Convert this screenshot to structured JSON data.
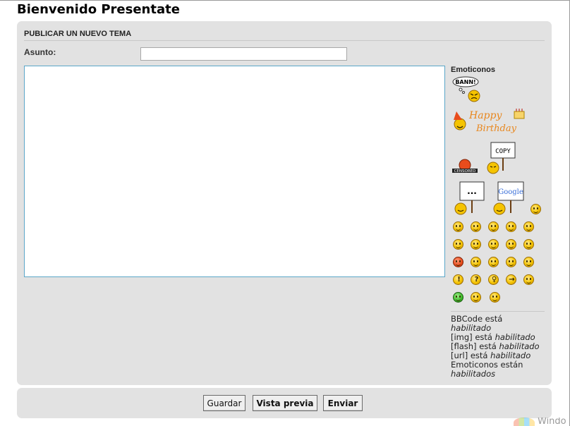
{
  "page": {
    "title": "Bienvenido Presentate"
  },
  "form": {
    "section_title": "PUBLICAR UN NUEVO TEMA",
    "subject_label": "Asunto:",
    "subject_value": "",
    "message_value": ""
  },
  "emoticons": {
    "title": "Emoticonos",
    "large": [
      {
        "name": "bann-smiley-icon",
        "text": "BANN!"
      },
      {
        "name": "happy-birthday-smiley-icon",
        "text": "Happy Birthday"
      },
      {
        "name": "censored-smiley-icon",
        "text": "CENSORED"
      },
      {
        "name": "copy-sign-smiley-icon",
        "text": "COPY"
      },
      {
        "name": "speechless-sign-smiley-icon",
        "text": "..."
      },
      {
        "name": "google-sign-smiley-icon",
        "text": "Google"
      }
    ],
    "small": [
      "big-grin-icon",
      "smile-icon",
      "wink-icon",
      "shy-icon",
      "surprised-icon",
      "rolling-eyes-icon",
      "confused-icon",
      "cool-icon",
      "laugh-icon",
      "mad-icon",
      "razz-icon",
      "embarrassed-icon",
      "crying-icon",
      "evil-icon",
      "twisted-evil-icon",
      "roll-eyes-icon",
      "exclamation-icon",
      "question-icon",
      "idea-icon",
      "arrow-icon",
      "neutral-icon",
      "mr-green-icon",
      "geek-icon",
      "uber-geek-icon"
    ]
  },
  "bbcode": {
    "bbcode_text": "BBCode está",
    "bbcode_state": "habilitado",
    "img_text": "[img] está",
    "img_state": "habilitado",
    "flash_text": "[flash] está",
    "flash_state": "habilitado",
    "url_text": "[url] está",
    "url_state": "habilitado",
    "emoticons_text": "Emoticonos están",
    "emoticons_state": "habilitados"
  },
  "buttons": {
    "save": "Guardar",
    "preview": "Vista previa",
    "submit": "Enviar"
  },
  "taskbar": {
    "partial_text": "Windo"
  },
  "colors": {
    "panel_bg": "#e2e2e2",
    "textarea_border": "#5aa6c8",
    "smiley_yellow": "#f5c400"
  }
}
